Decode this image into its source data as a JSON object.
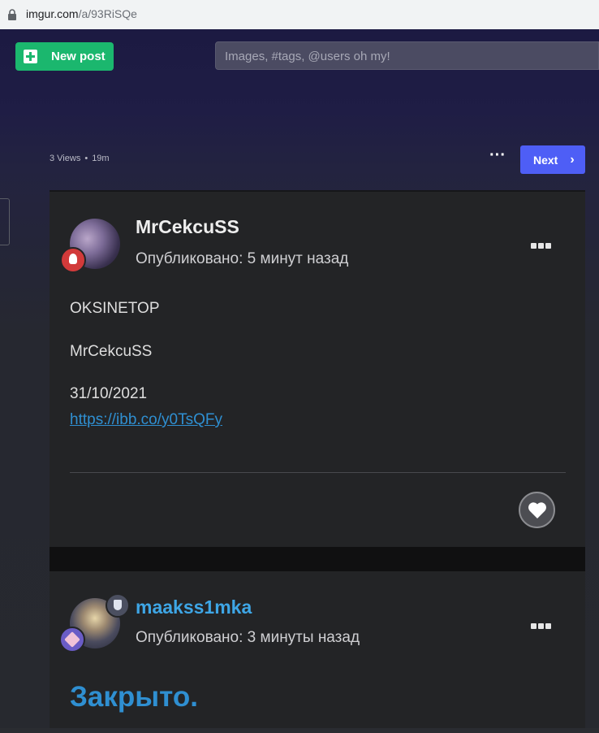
{
  "browser": {
    "url_domain": "imgur.com",
    "url_path": "/a/93RiSQe"
  },
  "header": {
    "new_post_label": "New post",
    "search_placeholder": "Images, #tags, @users oh my!"
  },
  "post_meta": {
    "views": "3 Views",
    "age": "19m",
    "separator": "•"
  },
  "navigation": {
    "next_label": "Next"
  },
  "comments": [
    {
      "username": "MrCekcuSS",
      "posted": "Опубликовано: 5 минут назад",
      "lines": [
        "OKSINETOP",
        "MrCekcuSS",
        "31/10/2021"
      ],
      "link": "https://ibb.co/y0TsQFy"
    },
    {
      "username": "maakss1mka",
      "posted": "Опубликовано: 3 минуты назад",
      "heading": "Закрыто."
    }
  ],
  "icons": {
    "lock": "lock-icon",
    "plus": "plus-icon",
    "more": "more-dots-icon",
    "chevron": "chevron-right-icon",
    "heart": "heart-icon"
  },
  "colors": {
    "accent_green": "#1bb76e",
    "accent_blue": "#4e5ef6",
    "username_blue": "#3ea6e6",
    "link_blue": "#2f8fd1"
  }
}
